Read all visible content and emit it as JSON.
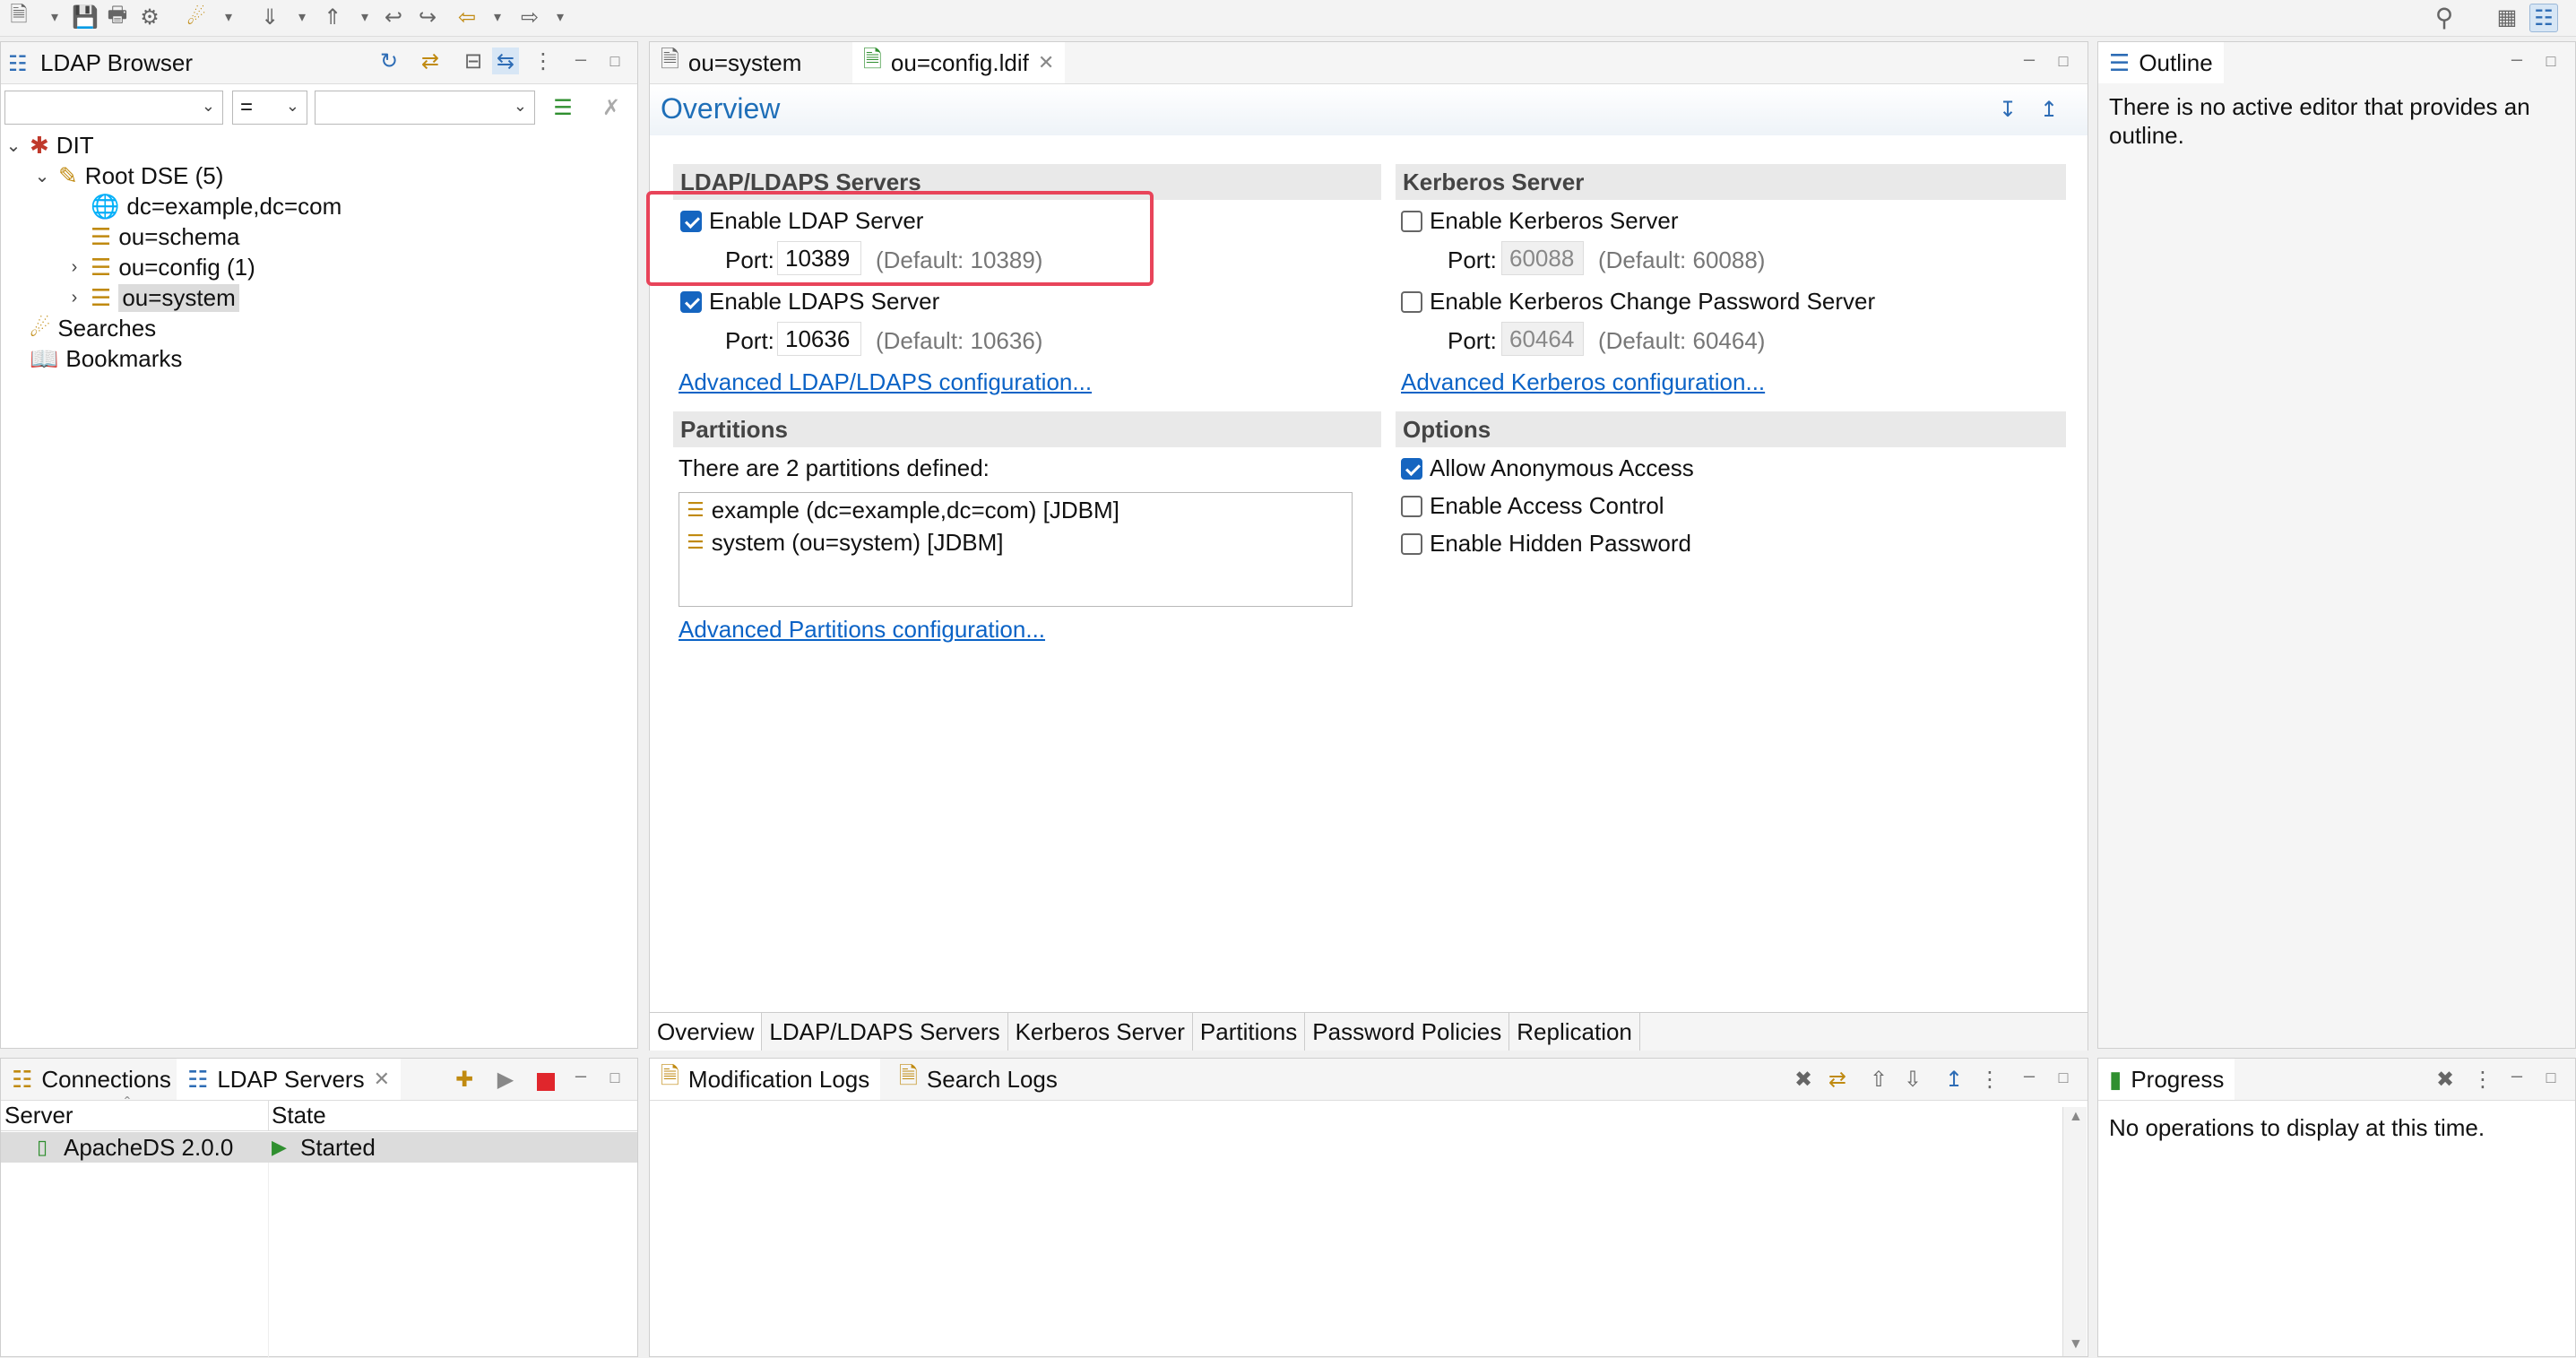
{
  "browser": {
    "title": "LDAP Browser",
    "operator_value": "=",
    "tree": {
      "dit": "DIT",
      "root_dse": "Root DSE (5)",
      "items": [
        "dc=example,dc=com",
        "ou=schema",
        "ou=config (1)",
        "ou=system"
      ],
      "searches": "Searches",
      "bookmarks": "Bookmarks"
    }
  },
  "editor": {
    "tabs": [
      "ou=system",
      "ou=config.ldif"
    ],
    "heading": "Overview",
    "ldap_section": {
      "title": "LDAP/LDAPS Servers",
      "enable_ldap": "Enable LDAP Server",
      "ldap_port_label": "Port:",
      "ldap_port": "10389",
      "ldap_default": "(Default: 10389)",
      "enable_ldaps": "Enable LDAPS Server",
      "ldaps_port_label": "Port:",
      "ldaps_port": "10636",
      "ldaps_default": "(Default: 10636)",
      "advanced_link": "Advanced LDAP/LDAPS configuration..."
    },
    "kerberos_section": {
      "title": "Kerberos Server",
      "enable_kerberos": "Enable Kerberos Server",
      "kerberos_port_label": "Port:",
      "kerberos_port": "60088",
      "kerberos_default": "(Default: 60088)",
      "enable_change_pw": "Enable Kerberos Change Password Server",
      "change_pw_port_label": "Port:",
      "change_pw_port": "60464",
      "change_pw_default": "(Default: 60464)",
      "advanced_link": "Advanced Kerberos configuration..."
    },
    "partitions_section": {
      "title": "Partitions",
      "summary": "There are 2 partitions defined:",
      "items": [
        "example (dc=example,dc=com) [JDBM]",
        "system (ou=system) [JDBM]"
      ],
      "advanced_link": "Advanced Partitions configuration..."
    },
    "options_section": {
      "title": "Options",
      "allow_anonymous": "Allow Anonymous Access",
      "access_control": "Enable Access Control",
      "hidden_password": "Enable Hidden Password"
    },
    "page_tabs": [
      "Overview",
      "LDAP/LDAPS Servers",
      "Kerberos Server",
      "Partitions",
      "Password Policies",
      "Replication"
    ]
  },
  "outline": {
    "title": "Outline",
    "message": "There is no active editor that provides an outline."
  },
  "connections": {
    "tabs": [
      "Connections",
      "LDAP Servers"
    ],
    "col_server": "Server",
    "col_state": "State",
    "row_server": "ApacheDS 2.0.0",
    "row_state": "Started"
  },
  "logs": {
    "tabs": [
      "Modification Logs",
      "Search Logs"
    ]
  },
  "progress": {
    "title": "Progress",
    "message": "No operations to display at this time."
  },
  "colors": {
    "accent": "#1565c0",
    "link": "#0b63c6",
    "highlight_box": "#e8445a",
    "stop_red": "#e0262c"
  }
}
